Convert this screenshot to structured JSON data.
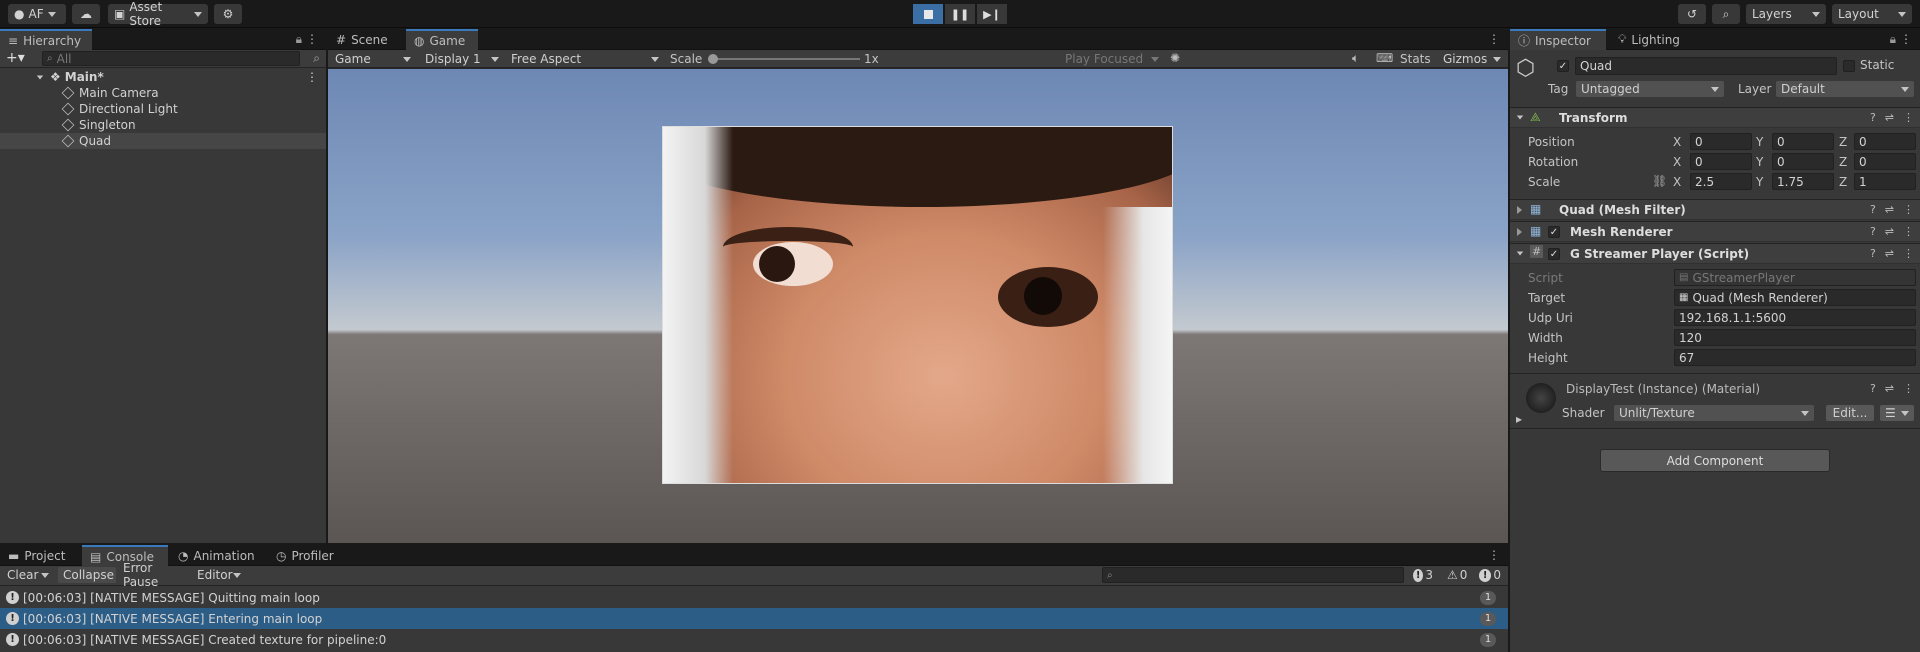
{
  "toolbar": {
    "account": "AF",
    "asset_store": "Asset Store",
    "layers": "Layers",
    "layout": "Layout"
  },
  "hierarchy": {
    "tab": "Hierarchy",
    "search_placeholder": "All",
    "scene": "Main*",
    "items": [
      "Main Camera",
      "Directional Light",
      "Singleton",
      "Quad"
    ]
  },
  "viewport": {
    "tabs": [
      "Scene",
      "Game"
    ],
    "mode": "Game",
    "display": "Display 1",
    "aspect": "Free Aspect",
    "scale_label": "Scale",
    "scale_value": "1x",
    "play_focused": "Play Focused",
    "stats": "Stats",
    "gizmos": "Gizmos"
  },
  "inspector": {
    "tabs": [
      "Inspector",
      "Lighting"
    ],
    "object_name": "Quad",
    "static": "Static",
    "tag_label": "Tag",
    "tag": "Untagged",
    "layer_label": "Layer",
    "layer": "Default",
    "transform": {
      "title": "Transform",
      "position_label": "Position",
      "rotation_label": "Rotation",
      "scale_label": "Scale",
      "position": [
        "0",
        "0",
        "0"
      ],
      "rotation": [
        "0",
        "0",
        "0"
      ],
      "scale": [
        "2.5",
        "1.75",
        "1"
      ],
      "axes": [
        "X",
        "Y",
        "Z"
      ]
    },
    "mesh_filter": "Quad (Mesh Filter)",
    "mesh_renderer": "Mesh Renderer",
    "script_comp": {
      "title": "G Streamer Player (Script)",
      "script_label": "Script",
      "script": "GStreamerPlayer",
      "target_label": "Target",
      "target": "Quad (Mesh Renderer)",
      "udp_label": "Udp Uri",
      "udp": "192.168.1.1:5600",
      "width_label": "Width",
      "width": "120",
      "height_label": "Height",
      "height": "67"
    },
    "material": {
      "title": "DisplayTest (Instance) (Material)",
      "shader_label": "Shader",
      "shader": "Unlit/Texture",
      "edit": "Edit..."
    },
    "add_component": "Add Component"
  },
  "bottom": {
    "tabs": [
      "Project",
      "Console",
      "Animation",
      "Profiler"
    ],
    "clear": "Clear",
    "collapse": "Collapse",
    "error_pause": "Error Pause",
    "editor": "Editor",
    "counts": {
      "info": "3",
      "warn": "0",
      "error": "0"
    },
    "logs": [
      {
        "text": "[00:06:03] [NATIVE MESSAGE] Quitting main loop",
        "count": "1"
      },
      {
        "text": "[00:06:03] [NATIVE MESSAGE] Entering main loop",
        "count": "1"
      },
      {
        "text": "[00:06:03] [NATIVE MESSAGE] Created texture for pipeline:0",
        "count": "1"
      }
    ]
  }
}
